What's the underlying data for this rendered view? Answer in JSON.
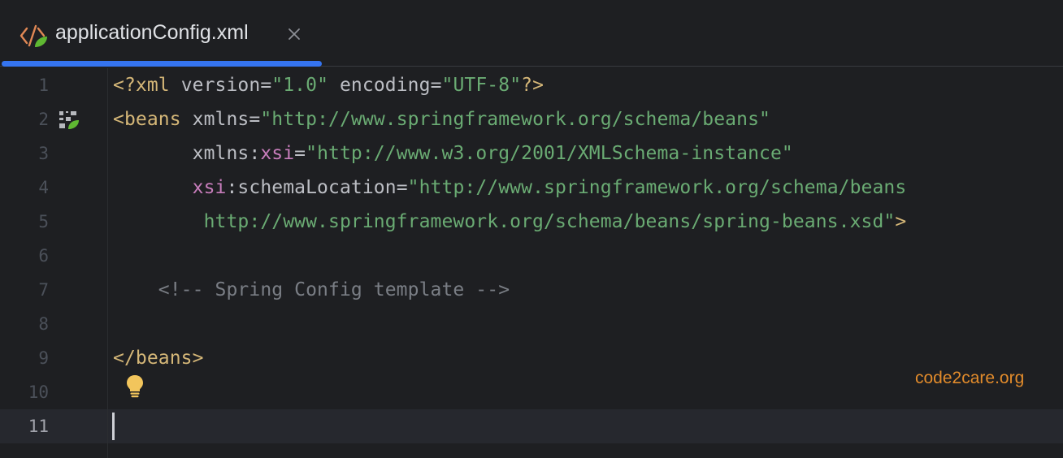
{
  "tab": {
    "title": "applicationConfig.xml",
    "icon": "xml-spring-icon",
    "close_icon": "close-icon",
    "accent_color": "#3574f0"
  },
  "editor": {
    "current_line": 11,
    "lines": [
      {
        "number": "1",
        "tokens": [
          {
            "text": "<?xml ",
            "kind": "tag"
          },
          {
            "text": "version",
            "kind": "attr"
          },
          {
            "text": "=",
            "kind": "attr"
          },
          {
            "text": "\"1.0\"",
            "kind": "val"
          },
          {
            "text": " ",
            "kind": "attr"
          },
          {
            "text": "encoding",
            "kind": "attr"
          },
          {
            "text": "=",
            "kind": "attr"
          },
          {
            "text": "\"UTF-8\"",
            "kind": "val"
          },
          {
            "text": "?>",
            "kind": "tag"
          }
        ]
      },
      {
        "number": "2",
        "gutter_icon": "spring-bean-icon",
        "tokens": [
          {
            "text": "<beans ",
            "kind": "tag"
          },
          {
            "text": "xmlns",
            "kind": "attr"
          },
          {
            "text": "=",
            "kind": "attr"
          },
          {
            "text": "\"http://www.springframework.org/schema/beans\"",
            "kind": "val"
          }
        ]
      },
      {
        "number": "3",
        "tokens": [
          {
            "text": "       xmlns:",
            "kind": "attr"
          },
          {
            "text": "xsi",
            "kind": "ns"
          },
          {
            "text": "=",
            "kind": "attr"
          },
          {
            "text": "\"http://www.w3.org/2001/XMLSchema-instance\"",
            "kind": "val"
          }
        ]
      },
      {
        "number": "4",
        "tokens": [
          {
            "text": "       ",
            "kind": "attr"
          },
          {
            "text": "xsi",
            "kind": "ns"
          },
          {
            "text": ":schemaLocation",
            "kind": "attr"
          },
          {
            "text": "=",
            "kind": "attr"
          },
          {
            "text": "\"http://www.springframework.org/schema/beans",
            "kind": "val"
          }
        ]
      },
      {
        "number": "5",
        "tokens": [
          {
            "text": "        http://www.springframework.org/schema/beans/spring-beans.xsd\"",
            "kind": "val"
          },
          {
            "text": ">",
            "kind": "tag"
          }
        ]
      },
      {
        "number": "6",
        "tokens": []
      },
      {
        "number": "7",
        "tokens": [
          {
            "text": "    <!-- Spring Config template -->",
            "kind": "comment"
          }
        ]
      },
      {
        "number": "8",
        "tokens": []
      },
      {
        "number": "9",
        "tokens": [
          {
            "text": "</beans>",
            "kind": "tag"
          }
        ]
      },
      {
        "number": "10",
        "tokens": []
      },
      {
        "number": "11",
        "tokens": []
      }
    ],
    "intention_icon": "lightbulb-icon",
    "watermark": "code2care.org"
  },
  "colors": {
    "background": "#1e1f22",
    "tag": "#d5b778",
    "namespace": "#c77dbb",
    "string": "#6aab73",
    "comment": "#7a7e85",
    "watermark": "#e28b2b"
  }
}
